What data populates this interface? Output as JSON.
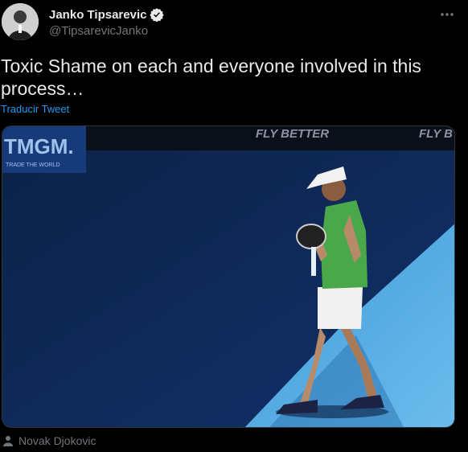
{
  "author": {
    "display_name": "Janko Tipsarevic",
    "handle": "@TipsarevicJanko",
    "verified": true,
    "avatar_icon": "profile-photo"
  },
  "tweet": {
    "text": "Toxic Shame on each and everyone involved in this process…",
    "translate_label": "Traducir Tweet"
  },
  "media": {
    "banner_left": "TMGM.",
    "banner_left_sub": "TRADE THE WORLD",
    "banner_center": "FLY BETTER",
    "banner_right": "FLY B"
  },
  "media_credit": {
    "icon": "person-icon",
    "name": "Novak Djokovic"
  },
  "colors": {
    "background": "#000000",
    "text": "#e7e9ea",
    "secondary": "#71767b",
    "link": "#1d9bf0",
    "court_dark": "#0e2a55",
    "court_light": "#4aa6e0"
  }
}
